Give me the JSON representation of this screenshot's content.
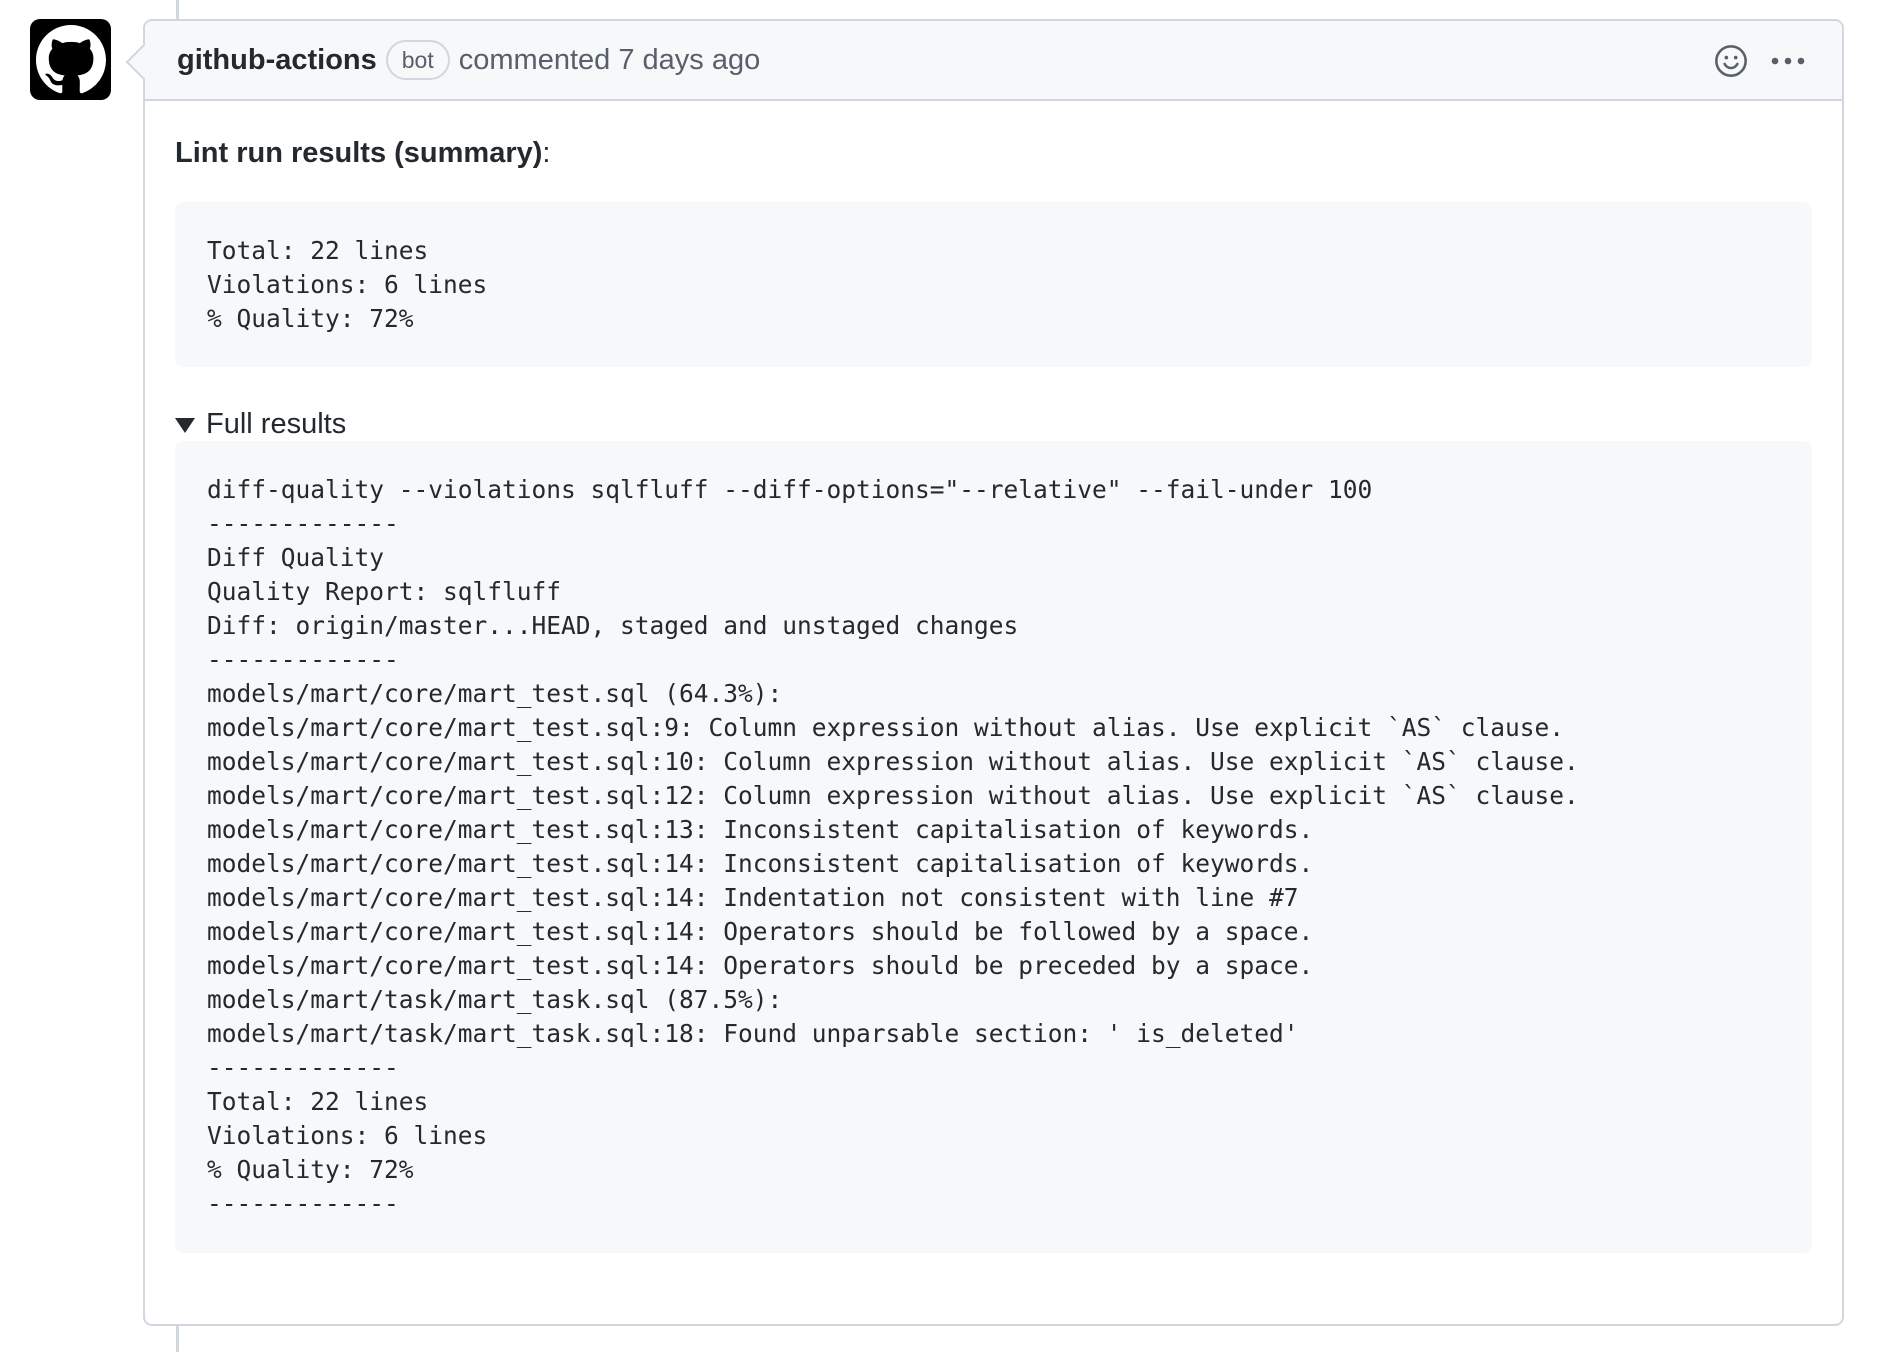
{
  "comment": {
    "author": "github-actions",
    "badge": "bot",
    "meta": "commented 7 days ago",
    "icons": {
      "avatar": "github-octocat-icon",
      "reaction": "smiley-icon",
      "more": "kebab-horizontal-icon",
      "details_toggle": "triangle-down-icon"
    },
    "body": {
      "heading_strong": "Lint run results (summary)",
      "heading_suffix": ":",
      "summary_code": "Total: 22 lines\nViolations: 6 lines\n% Quality: 72%",
      "details_label": "Full results",
      "full_code": "diff-quality --violations sqlfluff --diff-options=\"--relative\" --fail-under 100\n-------------\nDiff Quality\nQuality Report: sqlfluff\nDiff: origin/master...HEAD, staged and unstaged changes\n-------------\nmodels/mart/core/mart_test.sql (64.3%):\nmodels/mart/core/mart_test.sql:9: Column expression without alias. Use explicit `AS` clause.\nmodels/mart/core/mart_test.sql:10: Column expression without alias. Use explicit `AS` clause.\nmodels/mart/core/mart_test.sql:12: Column expression without alias. Use explicit `AS` clause.\nmodels/mart/core/mart_test.sql:13: Inconsistent capitalisation of keywords.\nmodels/mart/core/mart_test.sql:14: Inconsistent capitalisation of keywords.\nmodels/mart/core/mart_test.sql:14: Indentation not consistent with line #7\nmodels/mart/core/mart_test.sql:14: Operators should be followed by a space.\nmodels/mart/core/mart_test.sql:14: Operators should be preceded by a space.\nmodels/mart/task/mart_task.sql (87.5%):\nmodels/mart/task/mart_task.sql:18: Found unparsable section: ' is_deleted'\n-------------\nTotal: 22 lines\nViolations: 6 lines\n% Quality: 72%\n-------------"
    }
  },
  "colors": {
    "border": "#d0d7de",
    "header_bg": "#f6f8fa",
    "code_bg": "#f6f8fa",
    "text": "#24292f",
    "muted": "#57606a"
  }
}
